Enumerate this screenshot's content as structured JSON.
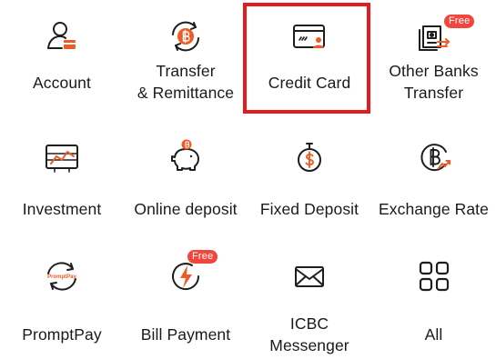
{
  "colors": {
    "icon_stroke": "#1e1e1e",
    "accent": "#f15a24",
    "badge": "#f0463c",
    "highlight": "#e8191d"
  },
  "items": [
    {
      "label_1": "Account",
      "icon": "account-icon"
    },
    {
      "label_1": "Transfer",
      "label_2": "& Remittance",
      "icon": "transfer-baht-icon"
    },
    {
      "label_1": "Credit Card",
      "icon": "credit-card-icon"
    },
    {
      "label_1": "Other Banks",
      "label_2": "Transfer",
      "icon": "other-banks-icon",
      "badge": "Free"
    },
    {
      "label_1": "Investment",
      "icon": "investment-chart-icon"
    },
    {
      "label_1": "Online deposit",
      "icon": "piggy-bank-icon"
    },
    {
      "label_1": "Fixed Deposit",
      "icon": "stopwatch-dollar-icon"
    },
    {
      "label_1": "Exchange Rate",
      "icon": "exchange-rate-icon"
    },
    {
      "label_1": "PromptPay",
      "icon": "promptpay-icon",
      "icon_text": "PromptPay"
    },
    {
      "label_1": "Bill Payment",
      "icon": "lightning-bill-icon",
      "badge": "Free"
    },
    {
      "label_1": "ICBC",
      "label_2": "Messenger",
      "icon": "envelope-icon"
    },
    {
      "label_1": "All",
      "icon": "grid-all-icon"
    }
  ]
}
